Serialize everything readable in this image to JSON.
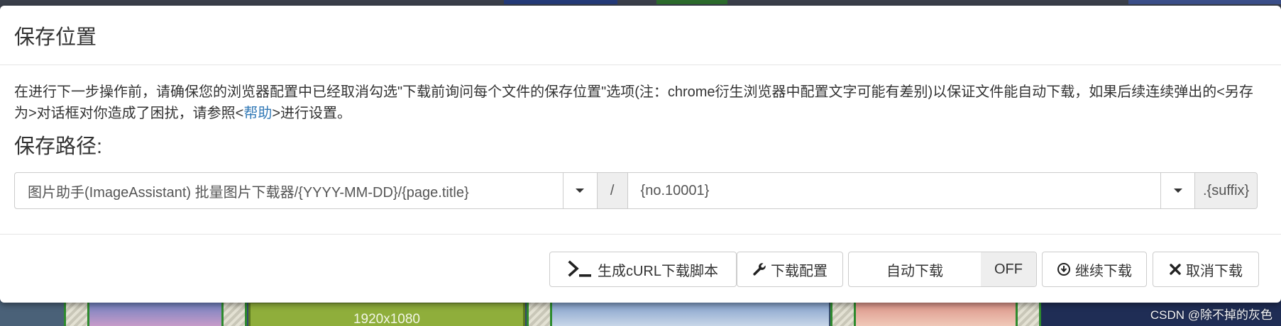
{
  "modal": {
    "title": "保存位置",
    "notice_before_link": "在进行下一步操作前，请确保您的浏览器配置中已经取消勾选\"下载前询问每个文件的保存位置\"选项(注：chrome衍生浏览器中配置文字可能有差别)以保证文件能自动下载，如果后续连续弹出的<另存为>对话框对你造成了困扰，请参照<",
    "help_link": "帮助",
    "notice_after_link": ">进行设置。",
    "path_label": "保存路径:",
    "path": {
      "folder_value": "图片助手(ImageAssistant) 批量图片下载器/{YYYY-MM-DD}/{page.title}",
      "separator": "/",
      "filename_value": "{no.10001}",
      "suffix": ".{suffix}"
    }
  },
  "footer": {
    "curl_button": "生成cURL下载脚本",
    "config_button": "下载配置",
    "auto_download_label": "自动下载",
    "auto_download_state": "OFF",
    "continue_button": "继续下载",
    "cancel_button": "取消下载"
  },
  "background": {
    "tile_label": "1920x1080",
    "watermark": "CSDN @除不掉的灰色"
  },
  "colors": {
    "link": "#337ab7",
    "addon_bg": "#eeeeee",
    "border": "#cccccc"
  }
}
